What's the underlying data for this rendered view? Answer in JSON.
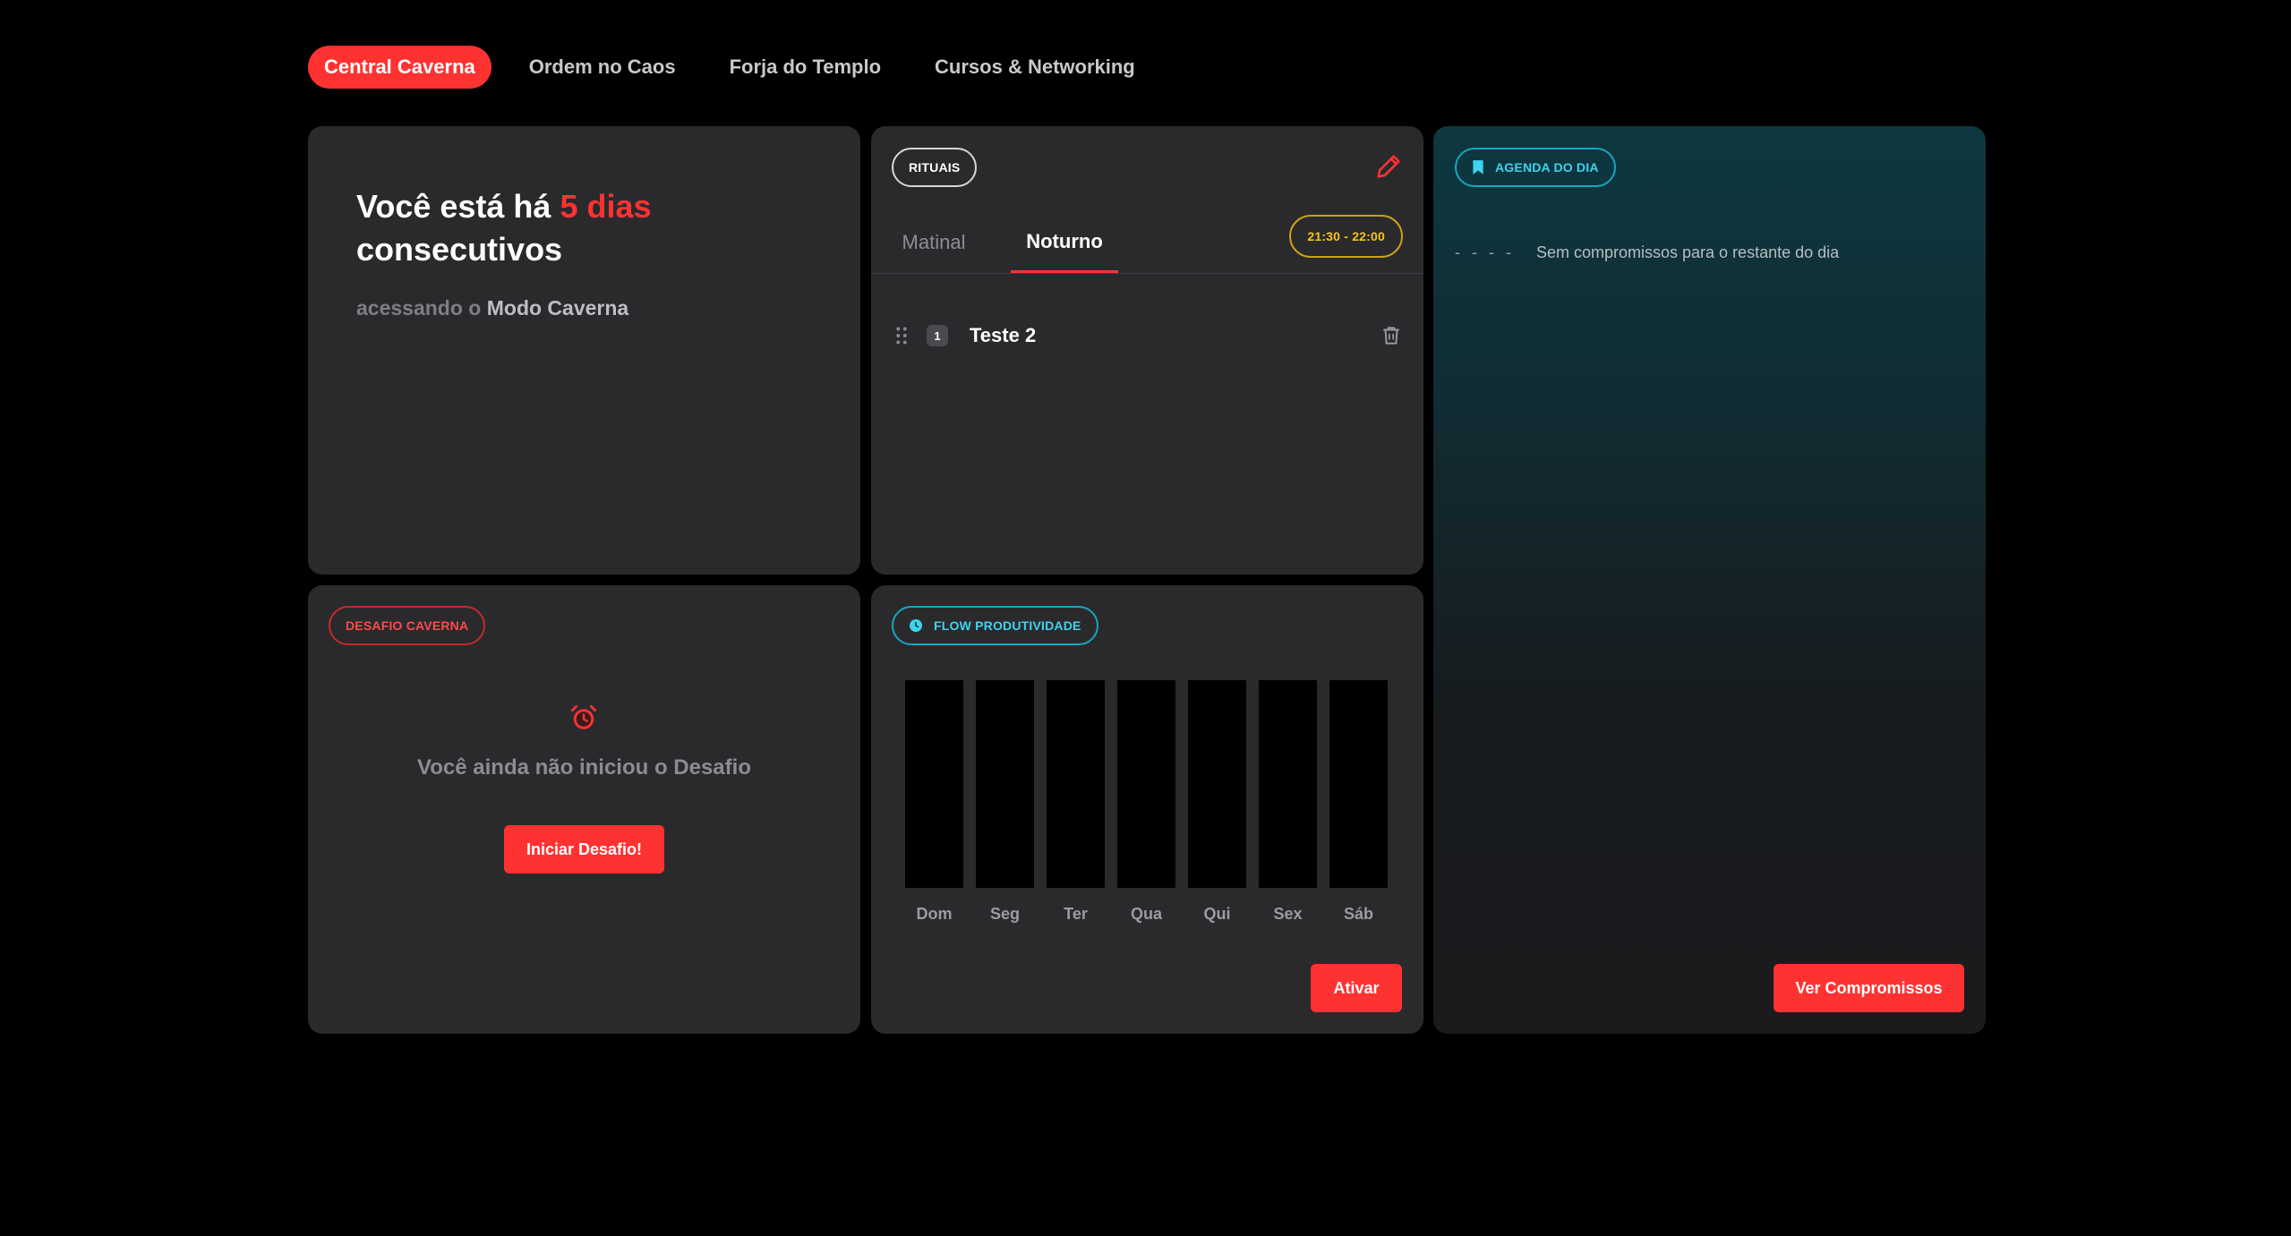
{
  "nav": {
    "items": [
      {
        "label": "Central Caverna",
        "active": true
      },
      {
        "label": "Ordem no Caos",
        "active": false
      },
      {
        "label": "Forja do Templo",
        "active": false
      },
      {
        "label": "Cursos & Networking",
        "active": false
      }
    ]
  },
  "streak": {
    "prefix": "Você está há",
    "highlight": "5 dias",
    "suffix": "consecutivos",
    "sub_prefix": "acessando o",
    "sub_strong": "Modo Caverna"
  },
  "rituals": {
    "badge": "RITUAIS",
    "tabs": [
      "Matinal",
      "Noturno"
    ],
    "active_tab": "Noturno",
    "time_range": "21:30 - 22:00",
    "items": [
      {
        "number": "1",
        "name": "Teste 2"
      }
    ]
  },
  "agenda": {
    "badge": "AGENDA DO DIA",
    "dashes": "- - - -",
    "empty_text": "Sem compromissos para o restante do dia",
    "button": "Ver Compromissos"
  },
  "challenge": {
    "badge": "DESAFIO CAVERNA",
    "text": "Você ainda não iniciou o Desafio",
    "button": "Iniciar Desafio!"
  },
  "flow": {
    "badge": "FLOW PRODUTIVIDADE",
    "days": [
      "Dom",
      "Seg",
      "Ter",
      "Qua",
      "Qui",
      "Sex",
      "Sáb"
    ],
    "values": [
      0,
      0,
      0,
      0,
      0,
      0,
      0
    ],
    "button": "Ativar"
  },
  "colors": {
    "accent": "#ff3232",
    "card": "#2a2a2d",
    "cyan": "#3fd3ee",
    "yellow": "#f5c518"
  }
}
